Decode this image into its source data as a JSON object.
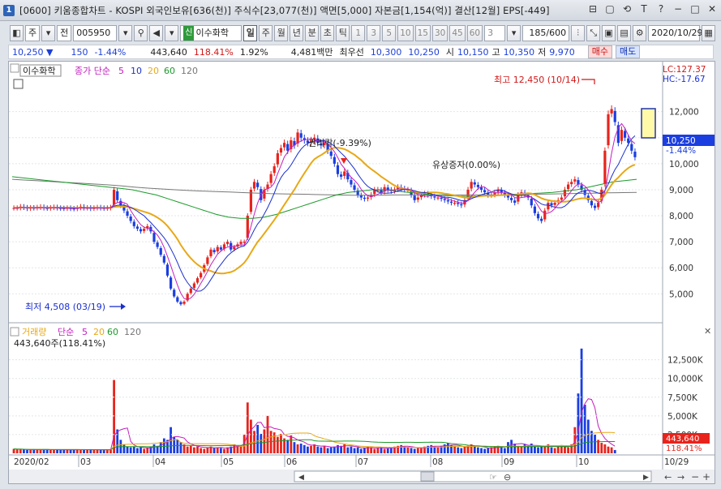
{
  "window": {
    "icon_label": "1",
    "title": "[0600] 키움종합차트 - KOSPI 외국인보유[636(천)] 주식수[23,077(천)] 액면[5,000] 자본금[1,154(억)] 결산[12월] EPS[-449]",
    "buttons": [
      "⊟",
      "▢",
      "⟲",
      "T",
      "?",
      "−",
      "□",
      "✕"
    ]
  },
  "toolbar": {
    "period_type": "주",
    "period_prev": "전",
    "stock_code": "005950",
    "badge": "신",
    "stock_name": "이수화학",
    "timeframes": [
      "일",
      "주",
      "월",
      "년",
      "분",
      "초",
      "틱"
    ],
    "active_timeframe": "일",
    "intervals": [
      "1",
      "3",
      "5",
      "10",
      "15",
      "30",
      "45",
      "60"
    ],
    "interval_select": "3",
    "count": "185/600",
    "date": "2020/10/29"
  },
  "infobar": {
    "price": "10,250 ▼",
    "change": "150",
    "change_pct": "-1.44%",
    "volume": "443,640",
    "volume_ratio": "118.41%",
    "turnover": "1.92%",
    "amount": "4,481백만",
    "bid_label": "최우선",
    "bid1": "10,300",
    "bid2": "10,250",
    "open_label": "시",
    "open": "10,150",
    "high_label": "고",
    "high": "10,350",
    "low_label": "저",
    "low": "9,970",
    "buy_label": "매수",
    "sell_label": "매도"
  },
  "colors": {
    "up": "#e8231c",
    "down": "#1a3ee0",
    "ma5": "#c31fbf",
    "ma10": "#1a2fd0",
    "ma20": "#e8a816",
    "ma60": "#1b9a2a",
    "ma120": "#777777",
    "vol_up": "#e8231c",
    "vol_down": "#1a3ee0"
  },
  "chart_data": {
    "type": "candlestick",
    "legend_name": "이수화학",
    "legend": {
      "label": "종가 단순",
      "periods": [
        "5",
        "10",
        "20",
        "60",
        "120"
      ]
    },
    "y_ticks": [
      "12,000",
      "11,000",
      "10,000",
      "9,000",
      "8,000",
      "7,000",
      "6,000",
      "5,000"
    ],
    "y_range": [
      4200,
      12800
    ],
    "lc_label": "LC:127.37",
    "hc_label": "HC:-17.67",
    "current_price": "10,250",
    "current_pct": "-1.44%",
    "annotations": {
      "high": "최고 12,450 (10/14)",
      "low": "최저 4,508 (03/19)",
      "rights": "권리락(-9.39%)",
      "capital": "유상증자(0.00%)"
    },
    "x_labels": [
      "2020/02",
      "03",
      "04",
      "05",
      "06",
      "07",
      "08",
      "09",
      "10",
      "10/29"
    ],
    "closes": [
      8300,
      8300,
      8350,
      8320,
      8280,
      8310,
      8300,
      8320,
      8340,
      8300,
      8290,
      8310,
      8330,
      8300,
      8290,
      8280,
      8300,
      8280,
      8270,
      8300,
      8350,
      8300,
      8310,
      8280,
      8300,
      8320,
      8300,
      8290,
      8300,
      8320,
      9000,
      8600,
      8400,
      8200,
      8000,
      7800,
      7600,
      7500,
      7400,
      7500,
      7600,
      7400,
      7000,
      6800,
      6500,
      6200,
      5700,
      5200,
      4900,
      4700,
      4600,
      4700,
      5000,
      5200,
      5400,
      5600,
      5800,
      6100,
      6400,
      6700,
      6600,
      6800,
      6700,
      6900,
      7000,
      6700,
      6800,
      6900,
      7000,
      7000,
      8000,
      9000,
      9300,
      9100,
      8600,
      9000,
      9200,
      9600,
      9900,
      10400,
      10600,
      10800,
      10500,
      10900,
      10700,
      11200,
      11000,
      10900,
      10800,
      10900,
      11000,
      10800,
      10700,
      10800,
      10500,
      10300,
      10000,
      9600,
      9500,
      9700,
      9400,
      9200,
      9000,
      8800,
      8700,
      8650,
      8700,
      8800,
      9000,
      9000,
      8900,
      9100,
      9000,
      8950,
      9000,
      9100,
      9050,
      9000,
      9000,
      8800,
      8600,
      8700,
      8800,
      8850,
      8800,
      8750,
      8700,
      8700,
      8650,
      8600,
      8550,
      8500,
      8500,
      8450,
      8400,
      8600,
      9000,
      9300,
      9200,
      9100,
      9000,
      8900,
      8800,
      8800,
      8900,
      9000,
      8900,
      8800,
      8700,
      8600,
      8500,
      8800,
      8900,
      8800,
      8700,
      8400,
      8100,
      7900,
      7800,
      8200,
      8500,
      8400,
      8500,
      8600,
      8700,
      9000,
      9200,
      9300,
      9400,
      9200,
      9000,
      8800,
      8600,
      8400,
      8300,
      8500,
      9000,
      10500,
      11900,
      12100,
      11600,
      10800,
      11300,
      11000,
      10800,
      10500,
      10250
    ],
    "ma60": [
      9500,
      9450,
      9400,
      9350,
      9300,
      9250,
      9200,
      9150,
      9100,
      9050,
      9000,
      8900,
      8800,
      8650,
      8500,
      8350,
      8200,
      8050,
      7950,
      7900,
      7900,
      7950,
      8050,
      8200,
      8350,
      8500,
      8650,
      8800,
      8900,
      8950,
      9000,
      9000,
      8950,
      8900,
      8850,
      8800,
      8780,
      8760,
      8750,
      8750,
      8780,
      8800,
      8830,
      8850,
      8870,
      8900,
      8950,
      9000,
      9100,
      9200,
      9300,
      9350,
      9400
    ],
    "ma120": [
      9400,
      9370,
      9340,
      9310,
      9280,
      9250,
      9220,
      9190,
      9150,
      9100,
      9060,
      9030,
      9000,
      8970,
      8950,
      8930,
      8910,
      8890,
      8870,
      8850,
      8840,
      8830,
      8820,
      8810,
      8800,
      8790,
      8790,
      8790,
      8800,
      8800,
      8800,
      8800,
      8800,
      8800,
      8800,
      8800,
      8800,
      8810,
      8820,
      8830,
      8840,
      8850,
      8860,
      8870,
      8880,
      8890,
      8900
    ],
    "volume_legend": {
      "label": "거래량",
      "type": "단순",
      "periods": [
        "5",
        "20",
        "60",
        "120"
      ]
    },
    "volume_info": "443,640주(118.41%)",
    "volume_ticks": [
      "12,500K",
      "10,000K",
      "7,500K",
      "5,000K",
      "2,500K"
    ],
    "volume_range": [
      0,
      14200
    ],
    "volume_current": "443,640",
    "volume_current_pct": "118.41%",
    "volumes": [
      600,
      500,
      550,
      500,
      450,
      500,
      480,
      520,
      500,
      470,
      500,
      450,
      520,
      480,
      460,
      500,
      470,
      450,
      480,
      500,
      520,
      480,
      460,
      500,
      470,
      450,
      480,
      500,
      460,
      480,
      9800,
      3200,
      1800,
      1200,
      900,
      800,
      900,
      700,
      800,
      600,
      700,
      900,
      1200,
      1000,
      1500,
      2000,
      1800,
      3500,
      2200,
      1800,
      1500,
      1200,
      900,
      1000,
      800,
      900,
      700,
      600,
      800,
      900,
      700,
      800,
      700,
      600,
      800,
      900,
      1200,
      1000,
      900,
      2500,
      6800,
      4500,
      3000,
      3800,
      2600,
      3200,
      5000,
      3000,
      2800,
      2200,
      2600,
      2000,
      1800,
      2400,
      1500,
      1200,
      1300,
      1100,
      900,
      1000,
      1200,
      900,
      800,
      1000,
      700,
      800,
      900,
      1100,
      1000,
      1200,
      800,
      900,
      700,
      800,
      600,
      700,
      900,
      800,
      600,
      700,
      800,
      600,
      700,
      800,
      900,
      1000,
      1100,
      900,
      800,
      700,
      600,
      700,
      800,
      900,
      1000,
      1100,
      900,
      800,
      1000,
      1200,
      1400,
      1100,
      900,
      800,
      700,
      900,
      1000,
      1200,
      900,
      800,
      700,
      600,
      700,
      800,
      900,
      1000,
      800,
      700,
      1500,
      1800,
      1300,
      1000,
      900,
      1200,
      1000,
      1300,
      900,
      800,
      1000,
      900,
      1200,
      800,
      700,
      900,
      1100,
      900,
      800,
      1200,
      3500,
      8000,
      14000,
      6500,
      4500,
      3000,
      2500,
      1800,
      1400,
      1200,
      900,
      800,
      443
    ]
  }
}
